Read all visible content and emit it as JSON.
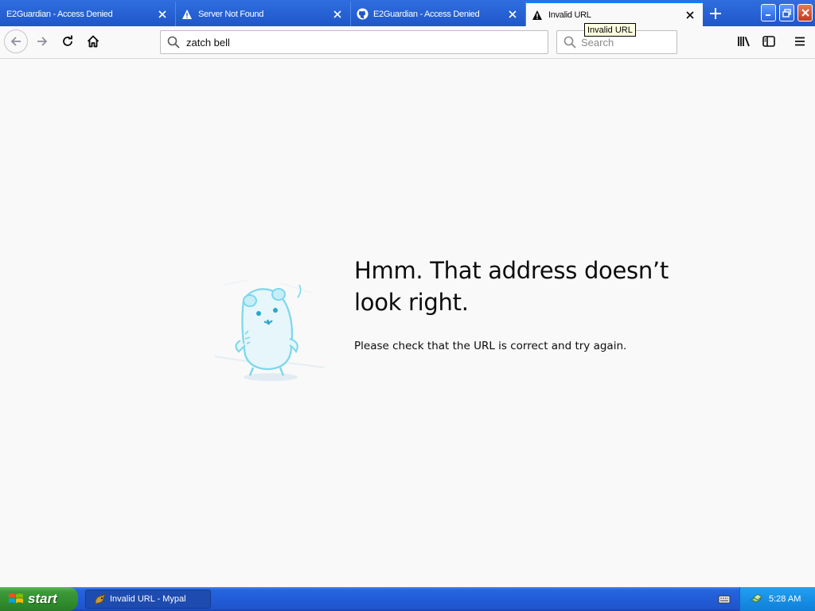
{
  "tabs": [
    {
      "label": "E2Guardian - Access Denied",
      "icon": "none"
    },
    {
      "label": "Server Not Found",
      "icon": "warning-icon"
    },
    {
      "label": "E2Guardian - Access Denied",
      "icon": "github-icon"
    },
    {
      "label": "Invalid URL",
      "icon": "warning-icon",
      "active": true
    }
  ],
  "tooltip": "Invalid URL",
  "urlbar": {
    "value": "zatch bell"
  },
  "searchbar": {
    "placeholder": "Search"
  },
  "error": {
    "title": "Hmm. That address doesn’t look right.",
    "description": "Please check that the URL is correct and try again."
  },
  "taskbar": {
    "start_label": "start",
    "task_label": "Invalid URL - Mypal",
    "clock": "5:28 AM"
  },
  "colors": {
    "accent": "#0a84ff",
    "xp_blue": "#225cd8",
    "xp_green": "#3c9a38"
  }
}
